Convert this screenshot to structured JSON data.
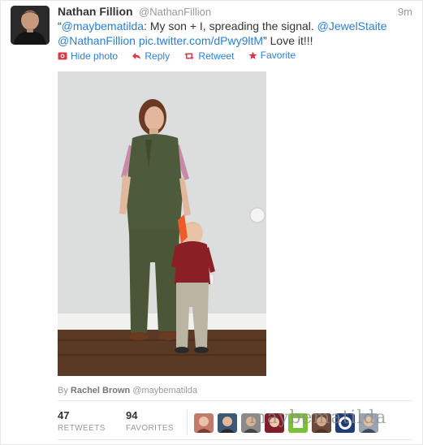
{
  "tweet": {
    "fullname": "Nathan Fillion",
    "username": "@NathanFillion",
    "time": "9m",
    "text_parts": {
      "quote_open": "“",
      "mention1": "@maybematilda",
      "body1": ": My son + I, spreading the signal. ",
      "mention2": "@JewelStaite",
      "space": " ",
      "mention3": "@NathanFillion",
      "space2": " ",
      "pic_link": "pic.twitter.com/dPwy9ltM",
      "body2": "” Love it!!!"
    }
  },
  "actions": {
    "hide_photo": "Hide photo",
    "reply": "Reply",
    "retweet": "Retweet",
    "favorite": "Favorite"
  },
  "credit": {
    "by": "By",
    "name": "Rachel Brown",
    "handle": "@maybematilda"
  },
  "stats": {
    "retweets_count": "47",
    "retweets_label": "RETWEETS",
    "favorites_count": "94",
    "favorites_label": "FAVORITES"
  },
  "watermark": "maybematilda",
  "colors": {
    "link": "#2a7fd4",
    "muted": "#999999",
    "text": "#333333"
  }
}
